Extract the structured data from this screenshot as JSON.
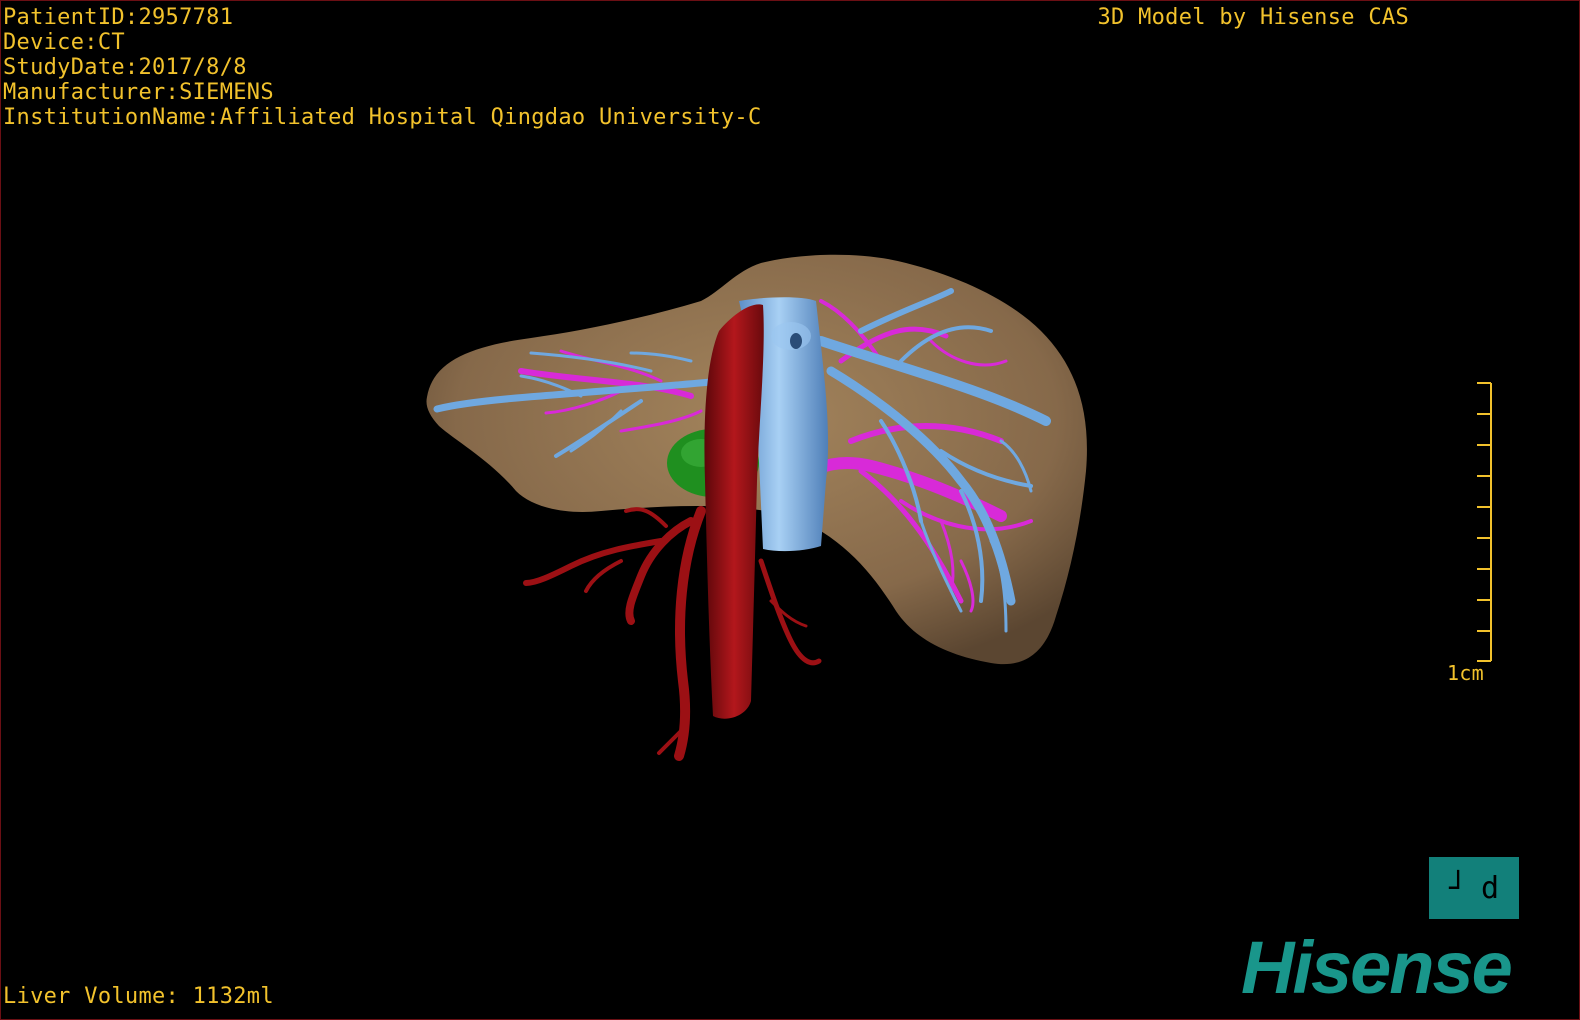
{
  "patient_info": {
    "patient_id": "PatientID:2957781",
    "device": "Device:CT",
    "study_date": "StudyDate:2017/8/8",
    "manufacturer": "Manufacturer:SIEMENS",
    "institution": "InstitutionName:Affiliated Hospital Qingdao University-C"
  },
  "header_right": "3D Model by Hisense CAS",
  "footer": {
    "liver_volume": "Liver Volume: 1132ml"
  },
  "scale": {
    "label": "1cm"
  },
  "orientation": {
    "left_glyph": "┘",
    "right_glyph": "d"
  },
  "logo": {
    "text": "Hisense"
  },
  "colors": {
    "overlay_text": "#f2c22c",
    "liver": "#8f7250",
    "hepatic_vein": "#6fa8e0",
    "portal_vein": "#d82ad8",
    "artery": "#9c1014",
    "gallbladder": "#1f8f1f",
    "brand": "#19968b"
  }
}
